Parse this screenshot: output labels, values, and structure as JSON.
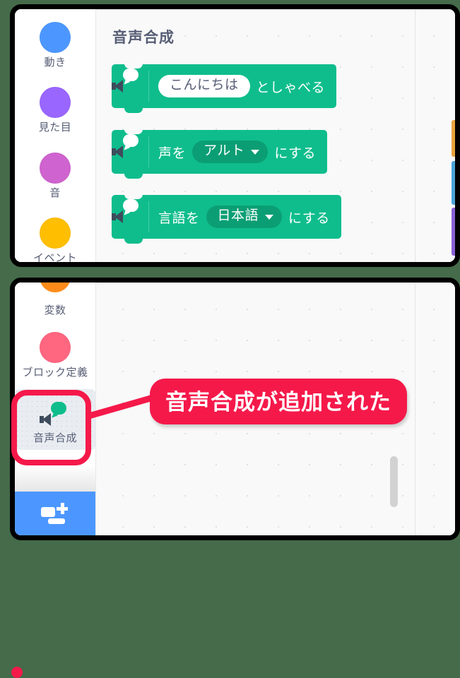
{
  "meta": {
    "background_color": "#456b4a",
    "accent_color": "#f5194a",
    "block_color": "#0fbd8c",
    "block_field_color": "#0b9e74"
  },
  "top_panel": {
    "palette_title": "音声合成",
    "categories": [
      {
        "label": "動き",
        "color": "#4c97ff",
        "icon": "category-dot-motion"
      },
      {
        "label": "見た目",
        "color": "#9966ff",
        "icon": "category-dot-looks"
      },
      {
        "label": "音",
        "color": "#cf63cf",
        "icon": "category-dot-sound"
      },
      {
        "label": "イベント",
        "color": "#ffbf00",
        "icon": "category-dot-events"
      }
    ],
    "blocks": [
      {
        "id": "speak-block",
        "icon": "text-to-speech-icon",
        "parts": [
          {
            "kind": "field-text",
            "value": "こんにちは"
          },
          {
            "kind": "label",
            "value": "としゃべる"
          }
        ]
      },
      {
        "id": "set-voice-block",
        "icon": "text-to-speech-icon",
        "parts": [
          {
            "kind": "label",
            "value": "声を"
          },
          {
            "kind": "field-dropdown",
            "value": "アルト"
          },
          {
            "kind": "label",
            "value": "にする"
          }
        ]
      },
      {
        "id": "set-language-block",
        "icon": "text-to-speech-icon",
        "parts": [
          {
            "kind": "label",
            "value": "言語を"
          },
          {
            "kind": "field-dropdown",
            "value": "日本語"
          },
          {
            "kind": "label",
            "value": "にする"
          }
        ]
      }
    ],
    "edge_tabs": [
      {
        "name": "edge-tab-orange",
        "color": "#e8a33d"
      },
      {
        "name": "edge-tab-blue",
        "color": "#4aa3d8"
      },
      {
        "name": "edge-tab-purple",
        "color": "#8a5fd6"
      }
    ]
  },
  "bottom_panel": {
    "categories": [
      {
        "label": "変数",
        "color": "#ff8c1a",
        "icon": "category-dot-variables"
      },
      {
        "label": "ブロック定義",
        "color": "#ff6680",
        "icon": "category-dot-my-blocks"
      }
    ],
    "selected_extension": {
      "label": "音声合成",
      "icon": "text-to-speech-icon"
    },
    "add_extension_button": {
      "icon": "add-extension-icon",
      "color": "#4c97ff"
    },
    "callout": {
      "text": "音声合成が追加された",
      "color": "#f5194a"
    }
  }
}
